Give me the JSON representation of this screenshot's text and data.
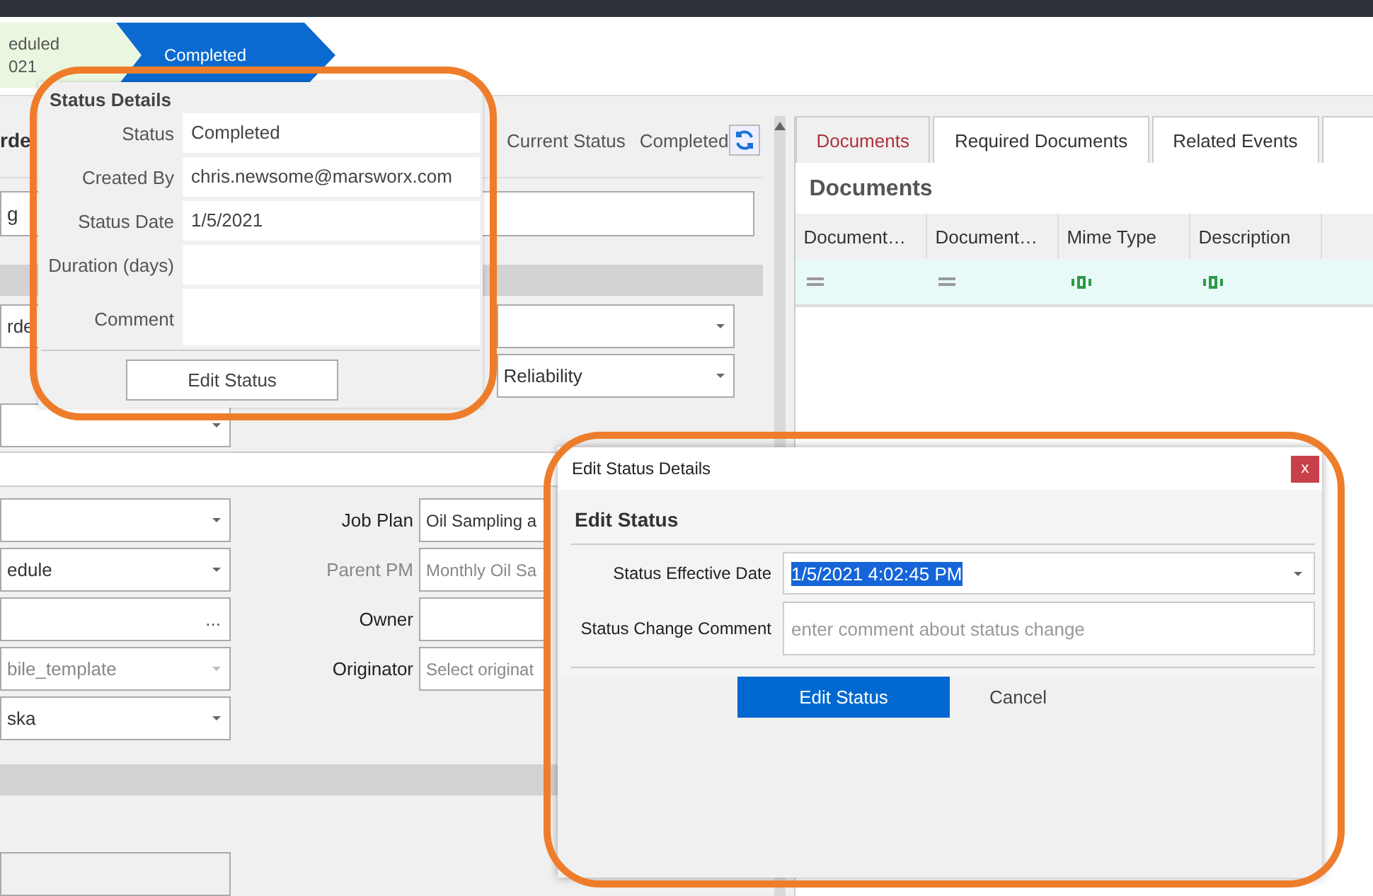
{
  "breadcrumb": [
    {
      "label": "eduled",
      "date": "021",
      "selected": false
    },
    {
      "label": "Completed",
      "selected": true
    }
  ],
  "header": {
    "title": "rde",
    "status_label": "Current Status",
    "status_value": "Completed"
  },
  "name_field": {
    "value": "g"
  },
  "section_top": {
    "left_value": "rde",
    "reason_value": "Reliability"
  },
  "lower_form": {
    "left": [
      {
        "kind": "dropdown"
      },
      {
        "kind": "dropdown",
        "value": "edule"
      },
      {
        "kind": "lookup",
        "button": "..."
      },
      {
        "kind": "dropdown",
        "value": "bile_template",
        "disabled": true
      },
      {
        "kind": "dropdown",
        "value": "ska"
      }
    ],
    "right": [
      {
        "label": "Job Plan",
        "value": "Oil Sampling a",
        "disabled": false
      },
      {
        "label": "Parent PM",
        "value": "Monthly Oil Sa",
        "disabled": true
      },
      {
        "label": "Owner"
      },
      {
        "label": "Originator",
        "placeholder": "Select originat"
      }
    ]
  },
  "right_panel": {
    "tabs": [
      {
        "label": "Documents",
        "selected": true
      },
      {
        "label": "Required Documents",
        "selected": false
      },
      {
        "label": "Related Events",
        "selected": false
      }
    ],
    "heading": "Documents",
    "table": {
      "columns": [
        "Document…",
        "Document…",
        "Mime Type",
        "Description"
      ],
      "filter_row": [
        {
          "kind": "equals"
        },
        {
          "kind": "equals"
        },
        {
          "kind": "text"
        },
        {
          "kind": "text"
        }
      ]
    }
  },
  "status_popup": {
    "title": "Status Details",
    "fields": [
      {
        "label": "Status",
        "value": "Completed",
        "kind": "line"
      },
      {
        "label": "Created By",
        "value": "chris.newsome@marsworx.com",
        "kind": "line"
      },
      {
        "label": "Status Date",
        "value": "1/5/2021",
        "kind": "line"
      },
      {
        "label": "Duration (days)",
        "kind": "line"
      },
      {
        "label": "Comment",
        "kind": "multiline"
      }
    ],
    "button": "Edit Status"
  },
  "dialog": {
    "title": "Edit Status Details",
    "close": "x",
    "heading": "Edit Status",
    "date_field": {
      "label": "Status Effective Date",
      "value": "1/5/2021 4:02:45 PM",
      "selected": true
    },
    "comment_field": {
      "label": "Status Change Comment",
      "placeholder": "enter comment about status change"
    },
    "buttons": [
      {
        "label": "Edit Status",
        "kind": "primary"
      },
      {
        "label": "Cancel",
        "kind": "link"
      }
    ]
  }
}
